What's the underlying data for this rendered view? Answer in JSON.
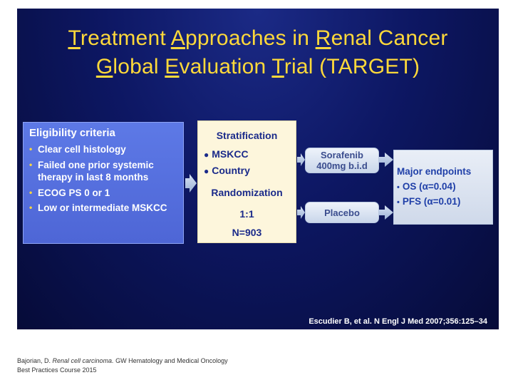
{
  "title": {
    "line1": [
      {
        "text": "T",
        "u": true
      },
      {
        "text": "reatment ",
        "u": false
      },
      {
        "text": "A",
        "u": true
      },
      {
        "text": "pproaches in ",
        "u": false
      },
      {
        "text": "R",
        "u": true
      },
      {
        "text": "enal Cancer",
        "u": false
      }
    ],
    "line2": [
      {
        "text": "G",
        "u": true
      },
      {
        "text": "lobal ",
        "u": false
      },
      {
        "text": "E",
        "u": true
      },
      {
        "text": "valuation ",
        "u": false
      },
      {
        "text": "T",
        "u": true
      },
      {
        "text": "rial (TARGET)",
        "u": false
      }
    ]
  },
  "eligibility": {
    "heading": "Eligibility criteria",
    "bullet": "•",
    "items": [
      "Clear cell histology",
      "Failed one prior systemic therapy in last 8 months",
      "ECOG PS 0 or 1",
      "Low or intermediate MSKCC"
    ]
  },
  "stratification": {
    "heading": "Stratification",
    "bullet": "●",
    "items": [
      "MSKCC",
      "Country"
    ],
    "randomization": "Randomization",
    "ratio": "1:1",
    "n": "N=903"
  },
  "arms": {
    "sorafenib_line1": "Sorafenib",
    "sorafenib_line2": "400mg b.i.d",
    "placebo": "Placebo"
  },
  "endpoints": {
    "heading": "Major endpoints",
    "bullet": "•",
    "items": [
      "OS (α=0.04)",
      "PFS (α=0.01)"
    ]
  },
  "reference": "Escudier B, et al. N Engl J Med 2007;356:125–34",
  "caption": {
    "prefix": "Bajorian, D. ",
    "italic": "Renal cell carcinoma.",
    "suffix": " GW Hematology and Medical Oncology Best Practices Course 2015"
  },
  "colors": {
    "title": "#ffd93a",
    "background": "#0d1763",
    "eligibility_box": "#5d79e6",
    "stratification_box": "#fdf6dc"
  }
}
